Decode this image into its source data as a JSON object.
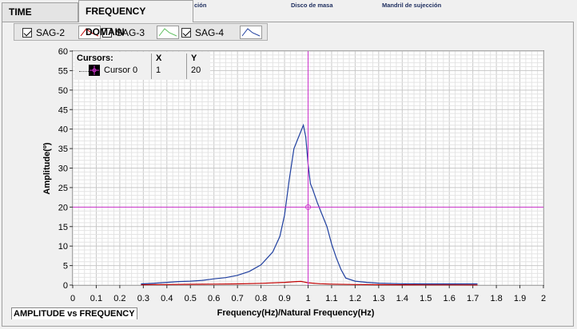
{
  "tabs": [
    {
      "label": "TIME DOMAIN",
      "active": false
    },
    {
      "label": "FREQUENCY DOMAIN",
      "active": true
    }
  ],
  "background_labels": [
    "ción",
    "Disco de masa",
    "Mandril de sujección"
  ],
  "legend": [
    {
      "label": "SAG-2",
      "checked": true,
      "color": "#c00000"
    },
    {
      "label": "SAG-3",
      "checked": false,
      "color": "#60c060"
    },
    {
      "label": "SAG-4",
      "checked": true,
      "color": "#1f3f9f"
    }
  ],
  "cursor_panel": {
    "header": "Cursors:",
    "col_x": "X",
    "col_y": "Y",
    "name": "Cursor 0",
    "x": "1",
    "y": "20",
    "color": "#cc33cc"
  },
  "caption": "AMPLITUDE vs FREQUENCY",
  "chart_data": {
    "type": "line",
    "xlabel": "Frequency(Hz)/Natural Frequency(Hz)",
    "ylabel": "Amplitude(º)",
    "xlim": [
      0,
      2
    ],
    "ylim": [
      0,
      60
    ],
    "x_ticks": [
      "0",
      "0.1",
      "0.2",
      "0.3",
      "0.4",
      "0.5",
      "0.6",
      "0.7",
      "0.8",
      "0.9",
      "1",
      "1.1",
      "1.2",
      "1.3",
      "1.4",
      "1.5",
      "1.6",
      "1.7",
      "1.8",
      "1.9",
      "2"
    ],
    "y_ticks": [
      "0",
      "5",
      "10",
      "15",
      "20",
      "25",
      "30",
      "35",
      "40",
      "45",
      "50",
      "55",
      "60"
    ],
    "grid": true,
    "series": [
      {
        "name": "SAG-2",
        "color": "#c00000",
        "x": [
          0.29,
          0.4,
          0.5,
          0.6,
          0.7,
          0.8,
          0.9,
          0.95,
          0.97,
          1.0,
          1.05,
          1.1,
          1.2,
          1.3,
          1.4,
          1.5,
          1.6,
          1.72
        ],
        "y": [
          0.1,
          0.15,
          0.2,
          0.25,
          0.3,
          0.45,
          0.7,
          0.9,
          0.95,
          0.6,
          0.35,
          0.25,
          0.15,
          0.1,
          0.08,
          0.07,
          0.06,
          0.05
        ]
      },
      {
        "name": "SAG-4",
        "color": "#1f3f9f",
        "x": [
          0.29,
          0.35,
          0.4,
          0.45,
          0.5,
          0.55,
          0.6,
          0.65,
          0.7,
          0.75,
          0.8,
          0.85,
          0.88,
          0.9,
          0.92,
          0.94,
          0.96,
          0.98,
          0.99,
          1.0,
          1.01,
          1.02,
          1.04,
          1.06,
          1.08,
          1.1,
          1.12,
          1.14,
          1.16,
          1.2,
          1.25,
          1.3,
          1.4,
          1.5,
          1.6,
          1.72
        ],
        "y": [
          0.3,
          0.5,
          0.7,
          0.9,
          1.0,
          1.2,
          1.6,
          1.9,
          2.5,
          3.5,
          5.2,
          8.5,
          12.5,
          18,
          27,
          35,
          38,
          41,
          38,
          31,
          26,
          24.5,
          21,
          18,
          15,
          10.5,
          7,
          4,
          1.8,
          1.0,
          0.7,
          0.5,
          0.35,
          0.3,
          0.3,
          0.3
        ]
      }
    ],
    "cursor": {
      "x": 1,
      "y": 20
    }
  }
}
